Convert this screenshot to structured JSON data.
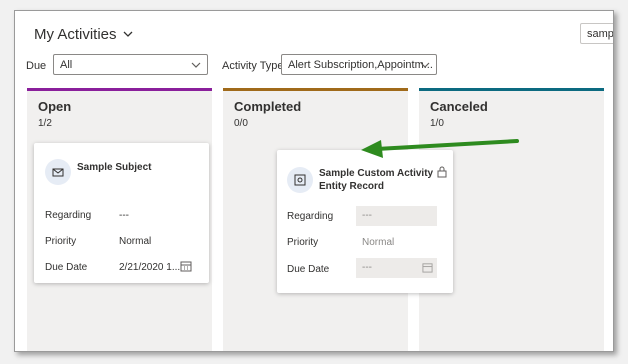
{
  "header": {
    "title": "My Activities",
    "search_value": "sample"
  },
  "filters": {
    "due_label": "Due",
    "due_value": "All",
    "activity_type_label": "Activity Type",
    "activity_type_value": "Alert Subscription,Appointm..."
  },
  "lanes": [
    {
      "name": "Open",
      "count": "1/2",
      "color": "#8a1f9b"
    },
    {
      "name": "Completed",
      "count": "0/0",
      "color": "#a06a1a"
    },
    {
      "name": "Canceled",
      "count": "1/0",
      "color": "#0c6a80"
    }
  ],
  "cards": {
    "open": {
      "title": "Sample Subject",
      "regarding_label": "Regarding",
      "regarding_value": "---",
      "priority_label": "Priority",
      "priority_value": "Normal",
      "due_label": "Due Date",
      "due_value": "2/21/2020 1...",
      "icon": "mail-icon"
    },
    "dragged": {
      "title": "Sample Custom Activity Entity Record",
      "regarding_label": "Regarding",
      "regarding_value": "---",
      "priority_label": "Priority",
      "priority_value": "Normal",
      "due_label": "Due Date",
      "due_value": "---",
      "icon": "custom-activity-icon"
    }
  },
  "colors": {
    "arrow": "#2e8b1f",
    "accent": "#0078d4"
  }
}
